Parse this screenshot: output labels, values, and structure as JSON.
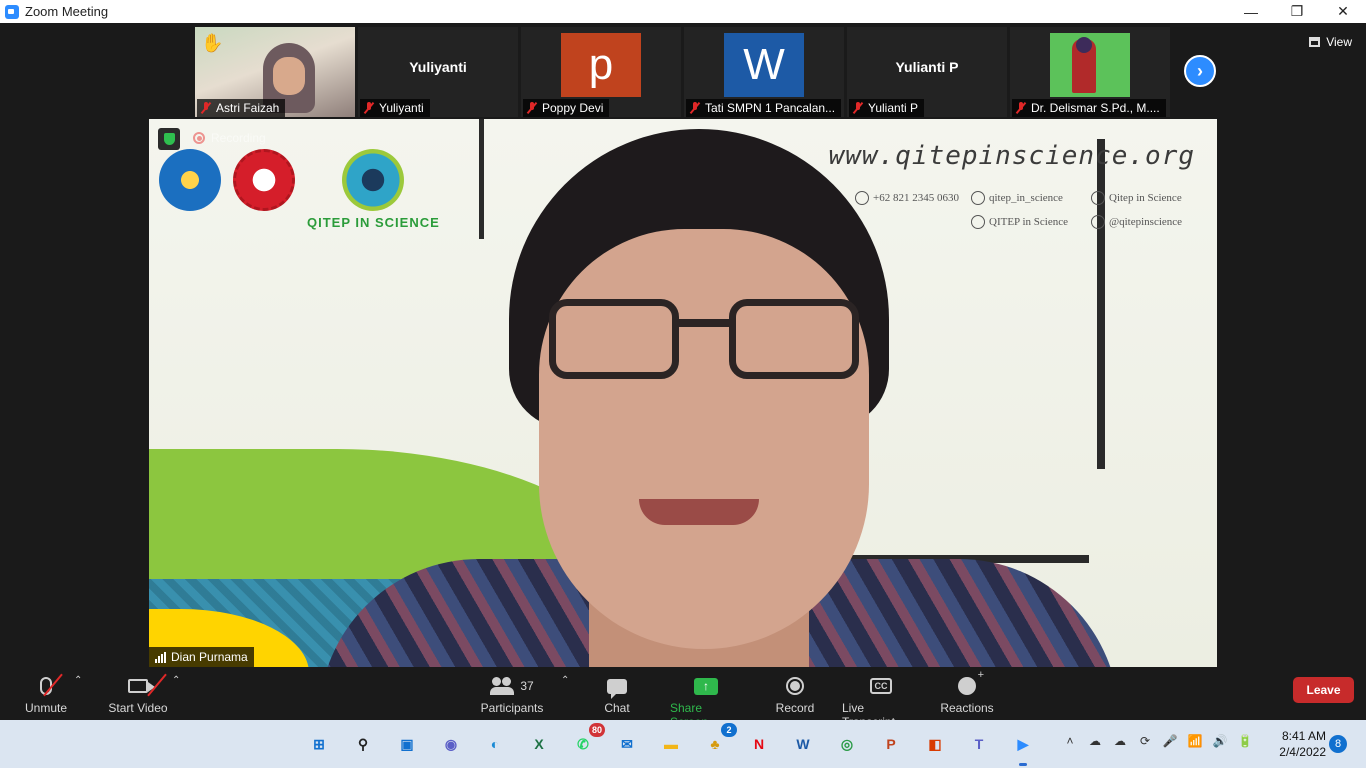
{
  "window": {
    "title": "Zoom Meeting",
    "controls": {
      "minimize": "—",
      "restore": "❐",
      "close": "✕"
    }
  },
  "view_button": {
    "label": "View"
  },
  "participants_strip": [
    {
      "name": "Astri Faizah",
      "muted": true,
      "raise_hand": true,
      "video": "camera"
    },
    {
      "name": "Yuliyanti",
      "muted": true,
      "display_name": "Yuliyanti",
      "video": "name"
    },
    {
      "name": "Poppy Devi",
      "muted": true,
      "avatar_letter": "p",
      "avatar_color": "#c0431e",
      "video": "avatar"
    },
    {
      "name": "Tati SMPN 1 Pancalan...",
      "muted": true,
      "avatar_letter": "W",
      "avatar_color": "#1d5aa6",
      "video": "avatar"
    },
    {
      "name": "Yulianti P",
      "muted": true,
      "display_name": "Yulianti P",
      "video": "name"
    },
    {
      "name": "Dr. Delismar S.Pd., M....",
      "muted": true,
      "video": "illustration"
    }
  ],
  "next_page_icon": "chevron-right-icon",
  "main_video": {
    "speaker_name": "Dian Purnama",
    "recording_label": "Recording",
    "background": {
      "website": "www.qitepinscience.org",
      "phone": "+62 821 2345 0630",
      "instagram": "qitep_in_science",
      "youtube": "Qitep in Science",
      "facebook": "QITEP in Science",
      "twitter": "@qitepinscience",
      "logo_text": "QITEP IN SCIENCE"
    }
  },
  "toolbar": {
    "unmute": "Unmute",
    "start_video": "Start Video",
    "participants": "Participants",
    "participants_count": "37",
    "chat": "Chat",
    "share_screen": "Share Screen",
    "record": "Record",
    "live_transcript": "Live Transcript",
    "reactions": "Reactions",
    "leave": "Leave",
    "share_color": "#2fb84c",
    "leave_color": "#c72b2b"
  },
  "taskbar": {
    "apps": [
      {
        "name": "start",
        "glyph": "⊞",
        "color": "#1170cf"
      },
      {
        "name": "search",
        "glyph": "⚲",
        "color": "#222222"
      },
      {
        "name": "task-view",
        "glyph": "▣",
        "color": "#1170cf"
      },
      {
        "name": "teams-chat",
        "glyph": "◉",
        "color": "#5b5fc7"
      },
      {
        "name": "edge",
        "glyph": "◐",
        "color": "#1a8ad4"
      },
      {
        "name": "excel",
        "glyph": "X",
        "color": "#1d7144"
      },
      {
        "name": "whatsapp",
        "glyph": "✆",
        "color": "#25d366",
        "badge": "80"
      },
      {
        "name": "mail",
        "glyph": "✉",
        "color": "#1170cf"
      },
      {
        "name": "file-explorer",
        "glyph": "▬",
        "color": "#f2b619"
      },
      {
        "name": "solitaire",
        "glyph": "♣",
        "color": "#d69b0e",
        "badge": "2"
      },
      {
        "name": "netflix",
        "glyph": "N",
        "color": "#e50914"
      },
      {
        "name": "word",
        "glyph": "W",
        "color": "#1d5aa6"
      },
      {
        "name": "chrome",
        "glyph": "◎",
        "color": "#2c9b48"
      },
      {
        "name": "powerpoint",
        "glyph": "P",
        "color": "#c0431e"
      },
      {
        "name": "office",
        "glyph": "◧",
        "color": "#d83b01"
      },
      {
        "name": "teams",
        "glyph": "T",
        "color": "#5b5fc7"
      },
      {
        "name": "zoom",
        "glyph": "▶",
        "color": "#2d8cff",
        "active": true
      }
    ],
    "tray": [
      "˄",
      "☁",
      "☁",
      "⟳",
      "🎤",
      "📶",
      "🔊",
      "🔋"
    ],
    "time": "8:41 AM",
    "date": "2/4/2022",
    "notifications": "8"
  }
}
